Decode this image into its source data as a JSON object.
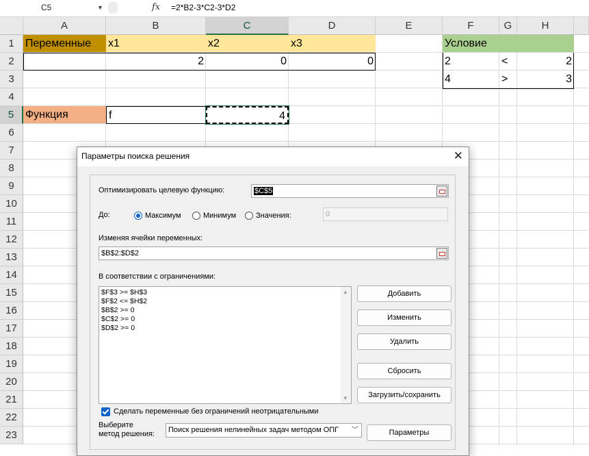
{
  "formula_bar": {
    "cell_ref": "C5",
    "fx": "fx",
    "formula": "=2*B2-3*C2-3*D2"
  },
  "columns": [
    "A",
    "B",
    "C",
    "D",
    "E",
    "F",
    "G",
    "H"
  ],
  "rows": [
    "1",
    "2",
    "3",
    "4",
    "5",
    "6",
    "7",
    "8",
    "9",
    "10",
    "11",
    "12",
    "13",
    "14",
    "15",
    "16",
    "17",
    "18",
    "19",
    "20",
    "21",
    "22",
    "23"
  ],
  "cells": {
    "A1": "Переменные",
    "B1": "x1",
    "C1": "x2",
    "D1": "x3",
    "B2": "2",
    "C2": "0",
    "D2": "0",
    "A5": "Функция",
    "B5": "f",
    "C5": "4",
    "F1": "Условие",
    "F2": "2",
    "G2": "<",
    "H2": "2",
    "F3": "4",
    "G3": ">",
    "H3": "3"
  },
  "colors": {
    "header_gold": "#bf8f00",
    "var_yellow": "#ffe699",
    "func_salmon": "#f4b084",
    "cond_green": "#a9d08e",
    "excel_green": "#217346",
    "accent_blue": "#0a63c9"
  },
  "dialog": {
    "title": "Параметры поиска решения",
    "objective_label": "Оптимизировать целевую функцию:",
    "objective_value": "$C$5",
    "to_label": "До:",
    "radio_max": "Максимум",
    "radio_min": "Минимум",
    "radio_value": "Значения:",
    "value_field": "0",
    "selected_option": "Максимум",
    "changing_label": "Изменяя ячейки переменных:",
    "changing_value": "$B$2:$D$2",
    "constraints_label": "В соответствии с ограничениями:",
    "constraints": [
      "$F$3 >= $H$3",
      "$F$2 <= $H$2",
      "$B$2 >= 0",
      "$C$2 >= 0",
      "$D$2 >= 0"
    ],
    "buttons": {
      "add": "Добавить",
      "change": "Изменить",
      "delete": "Удалить",
      "reset": "Сбросить",
      "load_save": "Загрузить/сохранить",
      "options": "Параметры"
    },
    "nonneg_checkbox": "Сделать переменные без ограничений неотрицательными",
    "nonneg_checked": true,
    "method_label_1": "Выберите",
    "method_label_2": "метод решения:",
    "method_value": "Поиск решения нелинейных задач методом ОПГ"
  }
}
